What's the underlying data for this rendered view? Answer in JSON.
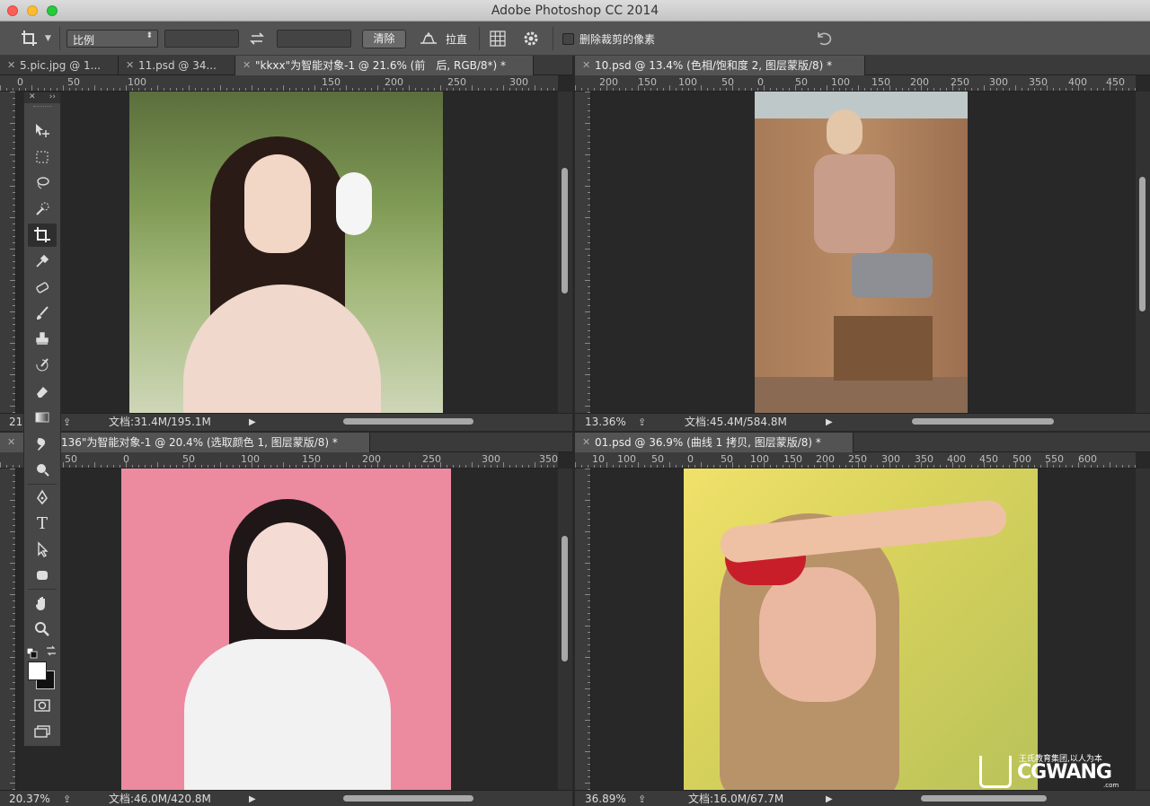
{
  "app": {
    "title": "Adobe Photoshop CC 2014"
  },
  "options": {
    "ratio_label": "比例",
    "clear_label": "清除",
    "straighten_label": "拉直",
    "delete_cropped_label": "删除裁剪的像素",
    "delete_cropped_checked": false
  },
  "panes": {
    "tl": {
      "tabs": [
        {
          "label": "5.pic.jpg @ 1..."
        },
        {
          "label": "11.psd @ 34..."
        },
        {
          "label": "\"kkxx\"为智能对象-1 @ 21.6% (前　后, RGB/8*) *"
        }
      ],
      "ruler": [
        "0",
        "50",
        "100",
        "150",
        "200",
        "250",
        "300"
      ],
      "zoom": "21",
      "doc": "文档:31.4M/195.1M"
    },
    "tr": {
      "tabs": [
        {
          "label": "10.psd @ 13.4% (色相/饱和度 2, 图层蒙版/8) *"
        }
      ],
      "ruler": [
        "200",
        "150",
        "100",
        "50",
        "0",
        "50",
        "100",
        "150",
        "200",
        "250",
        "300",
        "350",
        "400",
        "450"
      ],
      "zoom": "13.36%",
      "doc": "文档:45.4M/584.8M"
    },
    "bl": {
      "tabs": [
        {
          "label": "136\"为智能对象-1 @ 20.4% (选取颜色 1, 图层蒙版/8) *"
        }
      ],
      "ruler": [
        "50",
        "0",
        "50",
        "100",
        "150",
        "200",
        "250",
        "300",
        "350"
      ],
      "zoom": "20.37%",
      "doc": "文档:46.0M/420.8M"
    },
    "br": {
      "tabs": [
        {
          "label": "01.psd @ 36.9% (曲线 1 拷贝, 图层蒙版/8) *"
        }
      ],
      "ruler": [
        "10",
        "100",
        "50",
        "0",
        "50",
        "100",
        "150",
        "200",
        "250",
        "300",
        "350",
        "400",
        "450",
        "500",
        "550",
        "600"
      ],
      "zoom": "36.89%",
      "doc": "文档:16.0M/67.7M"
    }
  },
  "watermark": {
    "cn": "王氏教育集团,以人为本",
    "brand": "CGWANG",
    "domain": ".com"
  },
  "colors": {
    "accent": "#535353",
    "panel": "#3a3a3a",
    "canvas": "#282828"
  }
}
